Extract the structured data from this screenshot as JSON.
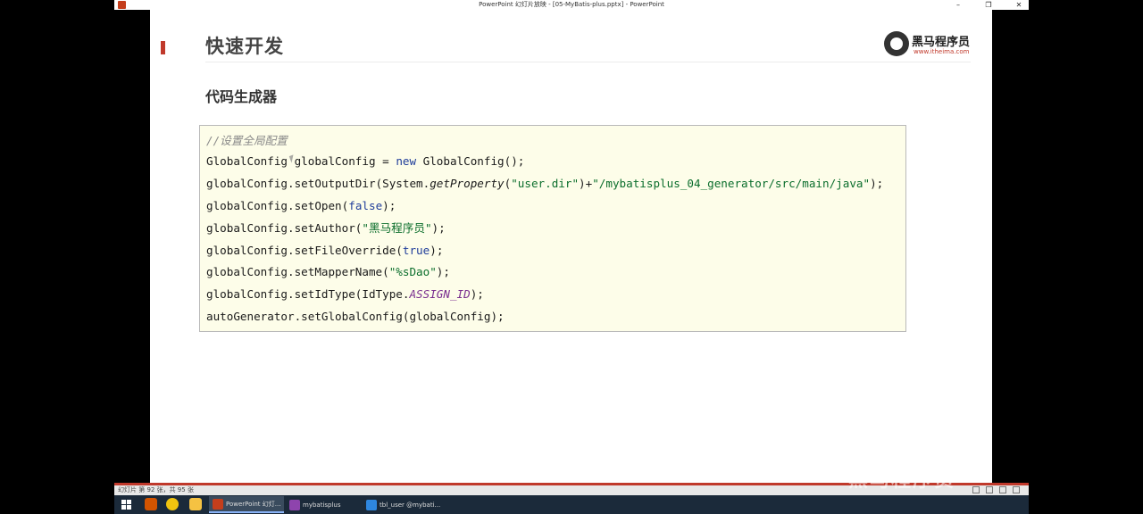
{
  "window": {
    "title": "PowerPoint 幻灯片放映 - [05-MyBatis-plus.pptx] - PowerPoint",
    "controls": [
      "–",
      "❐",
      "✕"
    ]
  },
  "slide": {
    "title": "快速开发",
    "subtitle": "代码生成器",
    "logo": {
      "name": "黑马程序员",
      "url": "www.itheima.com"
    },
    "code": {
      "comment": "//设置全局配置",
      "lines": [
        [
          "GlobalConfig globalConfig = ",
          {
            "kw": "new"
          },
          " GlobalConfig();"
        ],
        [
          "globalConfig.setOutputDir(System.",
          {
            "it": "getProperty"
          },
          "(",
          {
            "str": "\"user.dir\""
          },
          ")+",
          {
            "str": "\"/mybatisplus_04_generator/src/main/java\""
          },
          ");"
        ],
        [
          "globalConfig.setOpen(",
          {
            "kw": "false"
          },
          ");"
        ],
        [
          "globalConfig.setAuthor(",
          {
            "str": "\"黑马程序员\""
          },
          ");"
        ],
        [
          "globalConfig.setFileOverride(",
          {
            "kw": "true"
          },
          ");"
        ],
        [
          "globalConfig.setMapperName(",
          {
            "str": "\"%sDao\""
          },
          ");"
        ],
        [
          "globalConfig.setIdType(IdType.",
          {
            "const": "ASSIGN_ID"
          },
          ");"
        ],
        [
          "autoGenerator.setGlobalConfig(globalConfig);"
        ]
      ]
    }
  },
  "statusbar": {
    "text": "幻灯片 第 92 张，共 95 张"
  },
  "taskbar": {
    "apps": [
      {
        "label": "PowerPoint 幻灯...",
        "color": "#c43e1c",
        "active": true
      },
      {
        "label": "mybatisplus",
        "color": "#8e44ad",
        "active": false
      },
      {
        "label": "tbl_user @mybati...",
        "color": "#2e86de",
        "active": false
      }
    ]
  },
  "watermark": "黑马程序员·"
}
